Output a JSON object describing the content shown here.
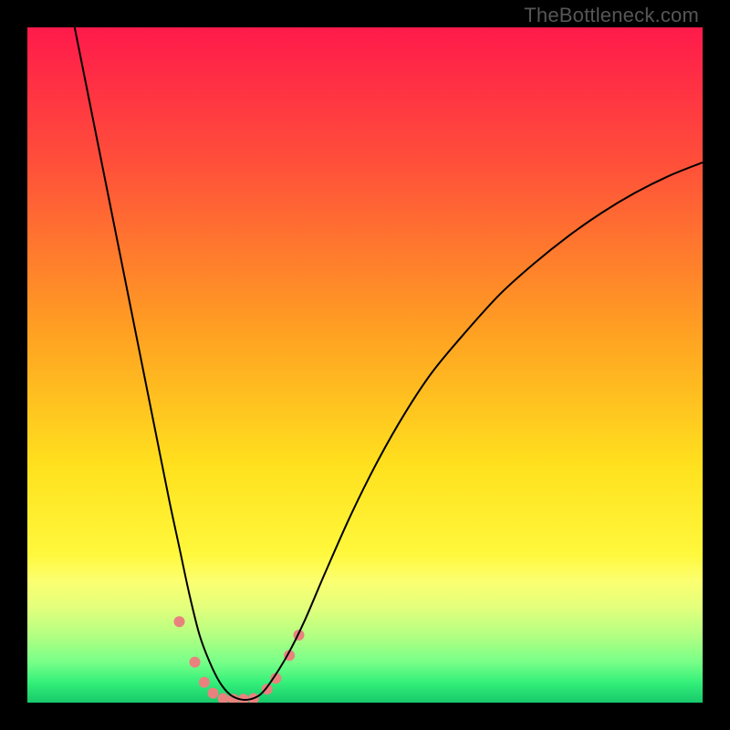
{
  "watermark": "TheBottleneck.com",
  "chart_data": {
    "type": "line",
    "title": "",
    "xlabel": "",
    "ylabel": "",
    "xlim": [
      0,
      100
    ],
    "ylim": [
      0,
      100
    ],
    "grid": false,
    "legend": false,
    "background_gradient": {
      "type": "vertical",
      "stops": [
        {
          "pos": 0.0,
          "color": "#ff1a4b"
        },
        {
          "pos": 0.2,
          "color": "#ff4f3a"
        },
        {
          "pos": 0.45,
          "color": "#ffa022"
        },
        {
          "pos": 0.65,
          "color": "#ffe11e"
        },
        {
          "pos": 0.78,
          "color": "#fff83c"
        },
        {
          "pos": 0.82,
          "color": "#fcff70"
        },
        {
          "pos": 0.86,
          "color": "#e2ff7c"
        },
        {
          "pos": 0.9,
          "color": "#b4ff82"
        },
        {
          "pos": 0.94,
          "color": "#78ff88"
        },
        {
          "pos": 0.97,
          "color": "#34f07a"
        },
        {
          "pos": 1.0,
          "color": "#17c96a"
        }
      ]
    },
    "series": [
      {
        "name": "bottleneck-curve",
        "color": "#000000",
        "width": 2,
        "x": [
          7.0,
          9.0,
          11.0,
          13.0,
          15.0,
          17.0,
          19.0,
          21.0,
          22.5,
          24.0,
          25.5,
          27.0,
          28.5,
          30.0,
          31.5,
          33.0,
          34.5,
          36.0,
          38.5,
          41.0,
          44.0,
          48.0,
          52.0,
          56.0,
          60.0,
          65.0,
          70.0,
          75.0,
          80.0,
          85.0,
          90.0,
          95.0,
          100.0
        ],
        "y": [
          100.0,
          90.0,
          80.0,
          70.0,
          60.0,
          50.0,
          40.0,
          30.0,
          23.0,
          16.0,
          10.0,
          6.0,
          3.0,
          1.2,
          0.5,
          0.5,
          1.2,
          3.0,
          7.0,
          12.0,
          19.0,
          28.0,
          36.0,
          43.0,
          49.0,
          55.0,
          60.5,
          65.0,
          69.0,
          72.5,
          75.5,
          78.0,
          80.0
        ]
      }
    ],
    "markers": {
      "name": "highlight-dots",
      "color": "#e9827f",
      "radius": 6,
      "points": [
        {
          "x": 22.5,
          "y": 12.0
        },
        {
          "x": 24.8,
          "y": 6.0
        },
        {
          "x": 26.2,
          "y": 3.0
        },
        {
          "x": 27.5,
          "y": 1.4
        },
        {
          "x": 29.0,
          "y": 0.6
        },
        {
          "x": 30.5,
          "y": 0.5
        },
        {
          "x": 32.0,
          "y": 0.5
        },
        {
          "x": 33.5,
          "y": 0.6
        },
        {
          "x": 35.5,
          "y": 2.0
        },
        {
          "x": 36.8,
          "y": 3.6
        },
        {
          "x": 38.8,
          "y": 7.0
        },
        {
          "x": 40.2,
          "y": 10.0
        }
      ]
    }
  }
}
